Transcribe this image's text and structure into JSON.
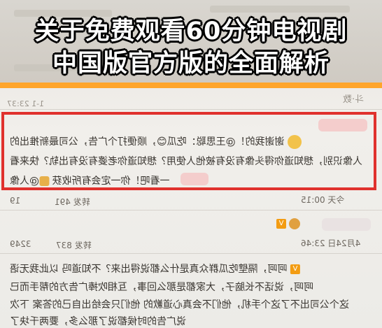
{
  "banner": {
    "line1": "关于免费观看60分钟电视剧",
    "line2": "中国版官方版的全面解析"
  },
  "screenshot": {
    "top_partial": "斗·数",
    "top_meta": "1-1 23:37",
    "comment1": {
      "line1": "谢谢我的！@王思聪：吃瓜😊，顺便打个广告，公司最新推出的",
      "line2": "人像识别，想知道你得头像有没有被他人使用？想知道你老婆有没有出轨？快来看",
      "line3": "一看吧！你一定会有所收获",
      "mention": "@人像",
      "time": "今天 00:15",
      "reply_count": "转发 491",
      "like_count": "19"
    },
    "comment2": {
      "avatar_tag": "V",
      "time": "4月24日 23:46",
      "repost": "转发 837",
      "like": "3249"
    },
    "comment3": {
      "line1": "呵呵，隔壁吃瓜群众真是什么都说得出来？不知道吗 以此我无语",
      "line2": "呵呵，说话不长脑子，大家都是那么回事，互相吹捧广告方的帮手而已",
      "line3": "这个公司出不了这个手机，他们不会真心道歉的 他们只会给出自己的答案 下次",
      "line4": "说广告的时候都说了那么多，要两千块了",
      "tag": "V"
    }
  }
}
